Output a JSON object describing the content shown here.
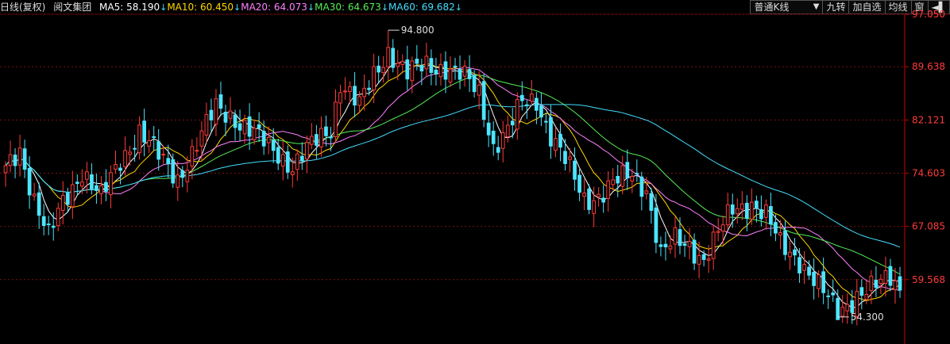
{
  "header": {
    "title": "日线(复权)",
    "stock": "阅文集团",
    "ma": [
      {
        "label": "MA5: 58.190",
        "color": "#ffffff",
        "arrow": "↓"
      },
      {
        "label": "MA10: 60.450",
        "color": "#ffd700",
        "arrow": "↓"
      },
      {
        "label": "MA20: 64.073",
        "color": "#ff80ff",
        "arrow": "↓"
      },
      {
        "label": "MA30: 64.673",
        "color": "#55ee55",
        "arrow": "↓"
      },
      {
        "label": "MA60: 69.682",
        "color": "#44ddff",
        "arrow": "↓"
      }
    ]
  },
  "toolbar": {
    "kline_type": "普通K线",
    "jiuzhuan": "九转",
    "add_watch": "加自选",
    "avg_line": "均线",
    "window": "窗"
  },
  "colors": {
    "up": "#ff3b3b",
    "down": "#4de5ff",
    "axis": "#cc0000",
    "axis_label": "#ff3b3b",
    "annotation": "#dddddd"
  },
  "chart_data": {
    "type": "candlestick",
    "ylim": [
      53.0,
      97.05
    ],
    "y_ticks": [
      "97.050",
      "89.638",
      "82.121",
      "74.603",
      "67.085",
      "59.568"
    ],
    "y_tick_values": [
      97.05,
      89.638,
      82.121,
      74.603,
      67.085,
      59.568
    ],
    "high_label": "94.800",
    "high_value": 94.8,
    "high_index": 80,
    "low_label": "54.300",
    "low_value": 54.3,
    "low_index": 174,
    "close_anchors": [
      [
        0,
        75.0
      ],
      [
        3,
        78.0
      ],
      [
        6,
        71.0
      ],
      [
        9,
        65.5
      ],
      [
        12,
        70.5
      ],
      [
        16,
        75.0
      ],
      [
        20,
        71.0
      ],
      [
        24,
        76.5
      ],
      [
        28,
        80.5
      ],
      [
        32,
        77.0
      ],
      [
        36,
        74.0
      ],
      [
        40,
        78.5
      ],
      [
        44,
        84.0
      ],
      [
        47,
        83.0
      ],
      [
        50,
        81.0
      ],
      [
        54,
        79.0
      ],
      [
        57,
        77.5
      ],
      [
        60,
        75.5
      ],
      [
        64,
        78.5
      ],
      [
        68,
        81.0
      ],
      [
        70,
        87.5
      ],
      [
        74,
        84.0
      ],
      [
        77,
        88.5
      ],
      [
        80,
        92.0
      ],
      [
        84,
        88.5
      ],
      [
        88,
        90.0
      ],
      [
        92,
        89.5
      ],
      [
        96,
        88.0
      ],
      [
        99,
        86.0
      ],
      [
        102,
        78.5
      ],
      [
        105,
        80.5
      ],
      [
        108,
        84.5
      ],
      [
        111,
        85.0
      ],
      [
        114,
        80.0
      ],
      [
        118,
        75.0
      ],
      [
        121,
        71.0
      ],
      [
        124,
        71.5
      ],
      [
        127,
        73.0
      ],
      [
        131,
        74.5
      ],
      [
        134,
        72.5
      ],
      [
        137,
        63.0
      ],
      [
        140,
        65.0
      ],
      [
        143,
        64.5
      ],
      [
        146,
        62.5
      ],
      [
        149,
        66.0
      ],
      [
        152,
        69.5
      ],
      [
        156,
        70.5
      ],
      [
        159,
        68.5
      ],
      [
        162,
        64.5
      ],
      [
        166,
        62.5
      ],
      [
        170,
        58.5
      ],
      [
        174,
        55.0
      ],
      [
        178,
        57.5
      ],
      [
        182,
        58.5
      ],
      [
        185,
        60.0
      ],
      [
        187,
        58.5
      ]
    ],
    "series": [
      {
        "name": "MA5",
        "period": 5,
        "color": "#ffffff"
      },
      {
        "name": "MA10",
        "period": 10,
        "color": "#ffd700"
      },
      {
        "name": "MA20",
        "period": 20,
        "color": "#ff80ff"
      },
      {
        "name": "MA30",
        "period": 30,
        "color": "#55ee55"
      },
      {
        "name": "MA60",
        "period": 60,
        "color": "#44ddff"
      }
    ]
  }
}
